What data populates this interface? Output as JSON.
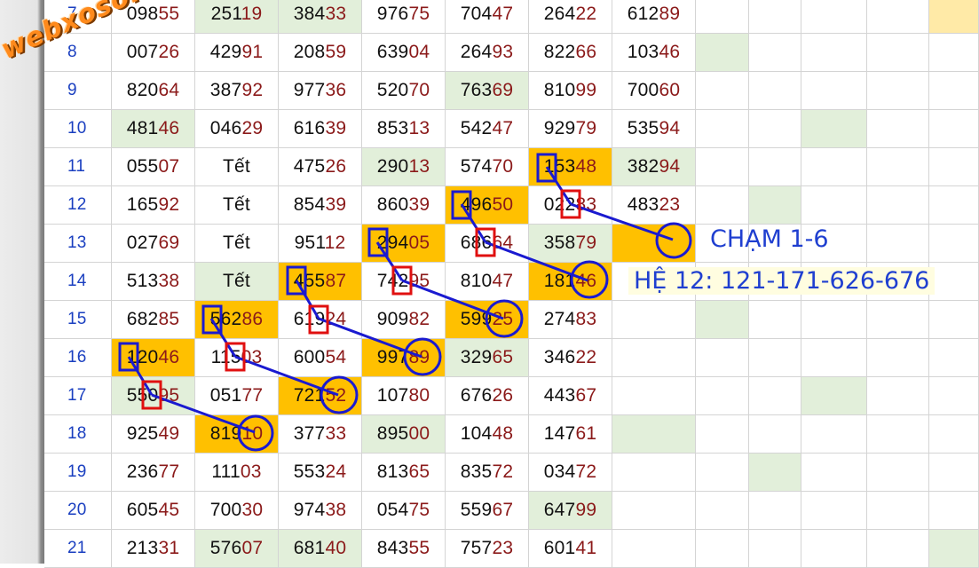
{
  "watermark": "webxoso.net",
  "labels": {
    "cham": "CHẠM 1-6",
    "he": "HỆ 12: 121-171-626-676"
  },
  "colors": {
    "green_fill": "#e2efda",
    "orange_fill": "#ffc000",
    "yellow_fill": "#ffeaa7",
    "marker_blue": "#1a1ad0",
    "marker_red": "#e01010",
    "number_tail": "#8b1a1a",
    "row_index": "#1a3fc0"
  },
  "rows": [
    {
      "index": "7",
      "values": [
        "09855",
        "25119",
        "38433",
        "97675",
        "70447",
        "26422",
        "61289"
      ],
      "green": [
        1,
        2
      ],
      "orange": [],
      "extra": {
        "green": [],
        "yellow": [
          4
        ]
      }
    },
    {
      "index": "8",
      "values": [
        "00726",
        "42991",
        "20859",
        "63904",
        "26493",
        "82266",
        "10346"
      ],
      "green": [],
      "orange": [],
      "extra": {
        "green": [
          0
        ],
        "yellow": []
      }
    },
    {
      "index": "9",
      "values": [
        "82064",
        "38792",
        "97736",
        "52070",
        "76369",
        "81099",
        "70060"
      ],
      "green": [
        4
      ],
      "orange": [],
      "extra": {
        "green": [],
        "yellow": []
      }
    },
    {
      "index": "10",
      "values": [
        "48146",
        "04629",
        "61639",
        "85313",
        "54247",
        "92979",
        "53594"
      ],
      "green": [
        0
      ],
      "orange": [],
      "extra": {
        "green": [
          2
        ],
        "yellow": []
      }
    },
    {
      "index": "11",
      "values": [
        "05507",
        "Tết",
        "47526",
        "29013",
        "57470",
        "15348",
        "38294"
      ],
      "green": [
        3,
        6
      ],
      "orange": [
        5
      ],
      "extra": {
        "green": [],
        "yellow": []
      }
    },
    {
      "index": "12",
      "values": [
        "16592",
        "Tết",
        "85439",
        "86039",
        "49650",
        "02283",
        "48323"
      ],
      "green": [],
      "orange": [
        4
      ],
      "extra": {
        "green": [
          1,
          5
        ],
        "yellow": []
      }
    },
    {
      "index": "13",
      "values": [
        "02769",
        "Tết",
        "95112",
        "29405",
        "68664",
        "35879",
        ""
      ],
      "green": [
        5
      ],
      "orange": [
        3,
        6
      ],
      "extra": {
        "green": [],
        "yellow": []
      }
    },
    {
      "index": "14",
      "values": [
        "51338",
        "Tết",
        "45587",
        "74295",
        "81047",
        "18146",
        ""
      ],
      "green": [
        1
      ],
      "orange": [
        2,
        5
      ],
      "extra": {
        "green": [],
        "yellow": []
      }
    },
    {
      "index": "15",
      "values": [
        "68285",
        "56286",
        "61924",
        "90982",
        "59925",
        "27483",
        ""
      ],
      "green": [],
      "orange": [
        1,
        4
      ],
      "extra": {
        "green": [
          0
        ],
        "yellow": []
      }
    },
    {
      "index": "16",
      "values": [
        "12046",
        "11503",
        "60054",
        "99789",
        "32965",
        "34622",
        ""
      ],
      "green": [
        4
      ],
      "orange": [
        0,
        3
      ],
      "extra": {
        "green": [],
        "yellow": []
      }
    },
    {
      "index": "17",
      "values": [
        "55095",
        "05177",
        "72152",
        "10780",
        "67626",
        "44367",
        ""
      ],
      "green": [
        0
      ],
      "orange": [
        2
      ],
      "extra": {
        "green": [
          2
        ],
        "yellow": []
      }
    },
    {
      "index": "18",
      "values": [
        "92549",
        "81910",
        "37733",
        "89500",
        "10448",
        "14761",
        ""
      ],
      "green": [
        3,
        6
      ],
      "orange": [
        1
      ],
      "extra": {
        "green": [],
        "yellow": []
      }
    },
    {
      "index": "19",
      "values": [
        "23677",
        "11103",
        "55324",
        "81365",
        "83572",
        "03472",
        ""
      ],
      "green": [],
      "orange": [],
      "extra": {
        "green": [
          1,
          5
        ],
        "yellow": []
      }
    },
    {
      "index": "20",
      "values": [
        "60545",
        "70030",
        "97438",
        "05475",
        "55967",
        "64799",
        ""
      ],
      "green": [
        5
      ],
      "orange": [],
      "extra": {
        "green": [],
        "yellow": []
      }
    },
    {
      "index": "21",
      "values": [
        "21331",
        "57607",
        "68140",
        "84355",
        "75723",
        "60141",
        ""
      ],
      "green": [
        1,
        2
      ],
      "orange": [],
      "extra": {
        "green": [
          4
        ],
        "yellow": []
      }
    }
  ]
}
